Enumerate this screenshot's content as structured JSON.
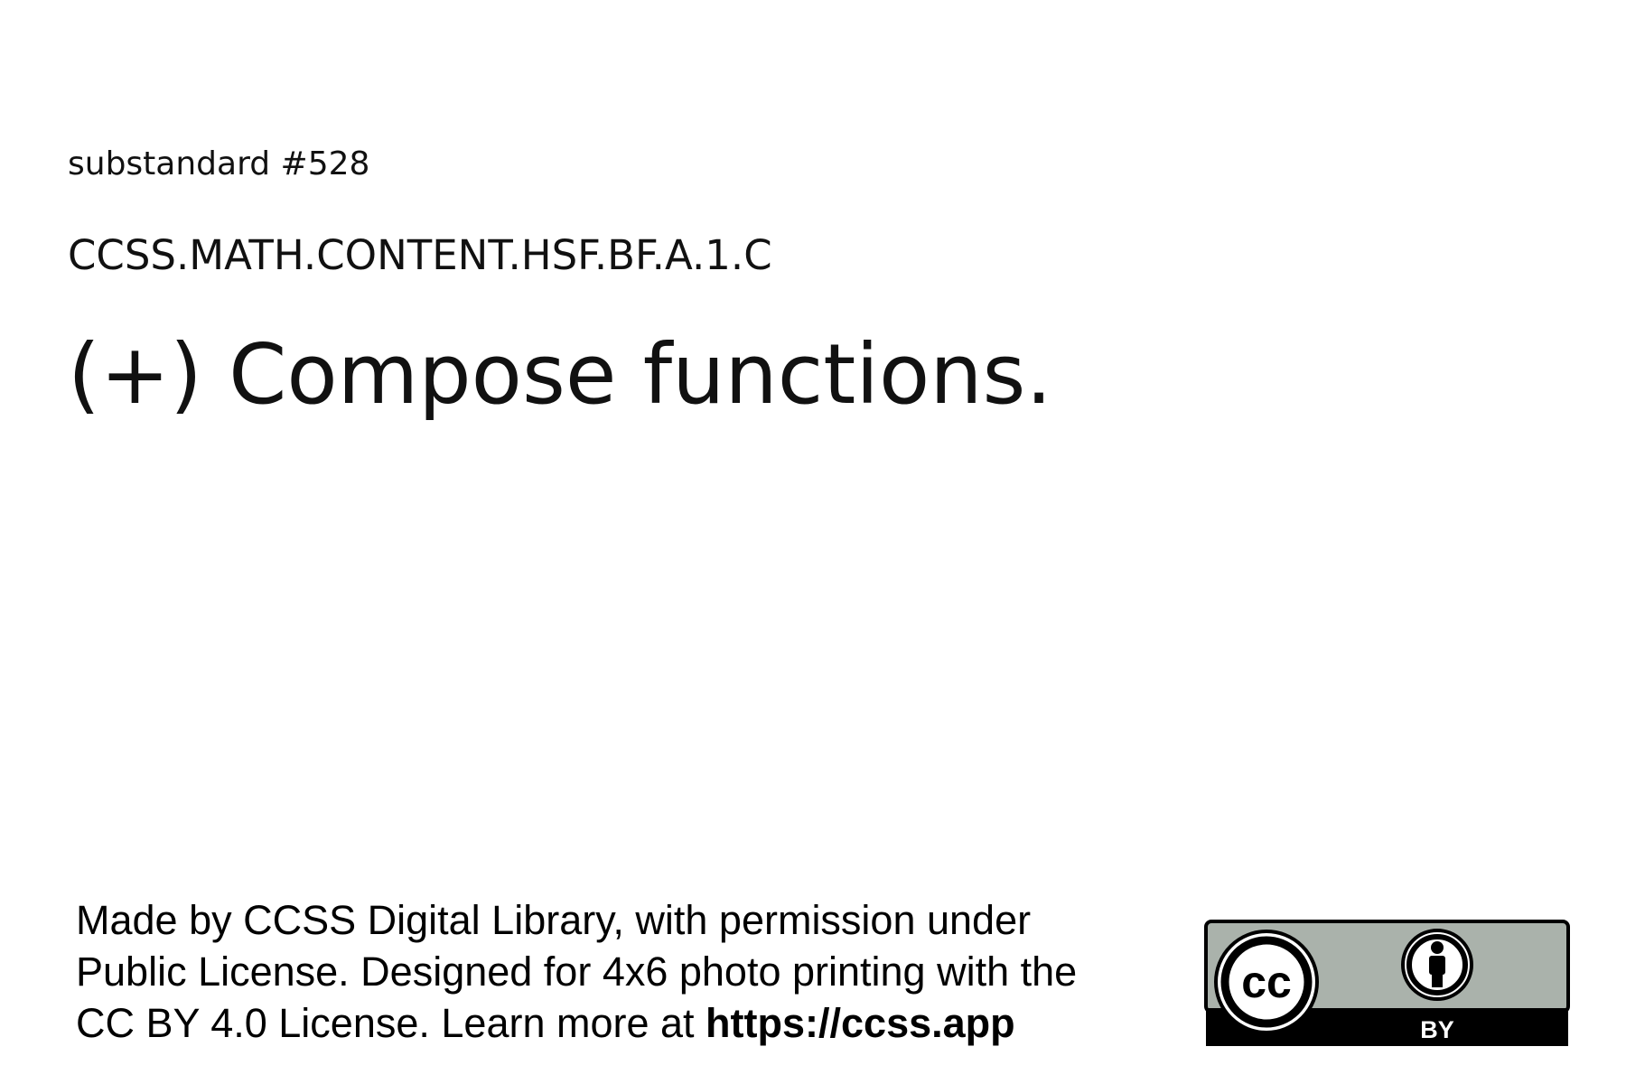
{
  "header": {
    "substandard": "substandard #528",
    "code": "CCSS.MATH.CONTENT.HSF.BF.A.1.C"
  },
  "main": {
    "standard_text": "(+) Compose functions."
  },
  "footer": {
    "line1": "Made by CCSS Digital Library, with permission under",
    "line2": "Public License. Designed for 4x6 photo printing with the",
    "line3_prefix": "CC BY 4.0 License. Learn more at ",
    "link": "https://ccss.app"
  },
  "license_badge": {
    "cc_text": "cc",
    "by_text": "BY",
    "colors": {
      "top_band": "#aab2ab",
      "bottom_band": "#000000",
      "border": "#000000"
    }
  }
}
